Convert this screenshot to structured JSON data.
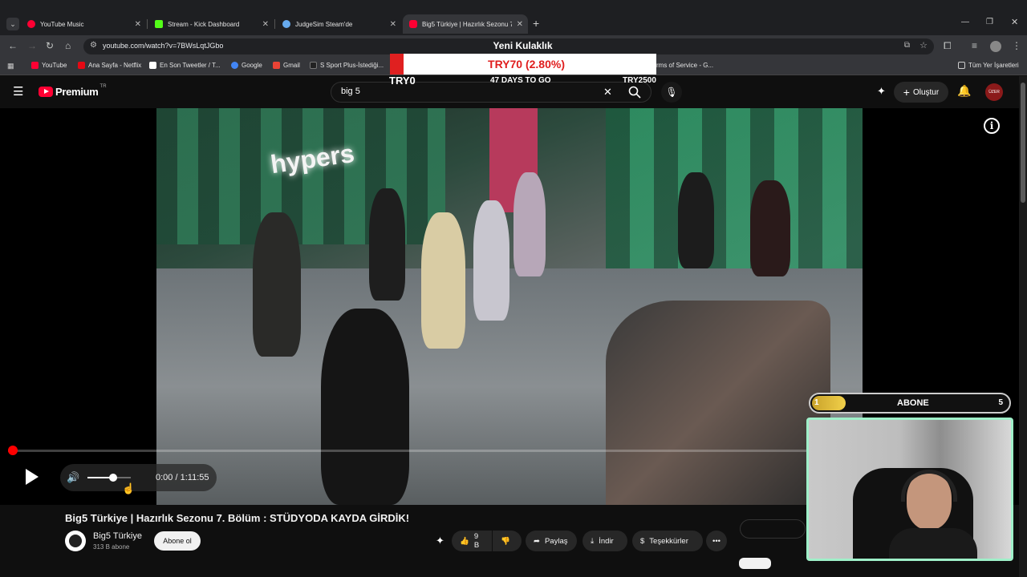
{
  "tabs": [
    {
      "title": "YouTube Music",
      "favicon_color": "#ff0033"
    },
    {
      "title": "Stream - Kick Dashboard",
      "favicon_color": "#53fc18"
    },
    {
      "title": "JudgeSim Steam'de",
      "favicon_color": "#66aaee"
    },
    {
      "title": "Big5 Türkiye | Hazırlık Sezonu 7.",
      "favicon_color": "#ff0033"
    }
  ],
  "omnibox": {
    "url": "youtube.com/watch?v=7BWsLqtJGbo"
  },
  "bookmarks": [
    {
      "label": "YouTube",
      "color": "#ff0033"
    },
    {
      "label": "Ana Sayfa - Netflix",
      "color": "#e50914"
    },
    {
      "label": "En Son Tweetler / T...",
      "color": "#ffffff"
    },
    {
      "label": "Google",
      "color": "#4285f4"
    },
    {
      "label": "Gmail",
      "color": "#ea4335"
    },
    {
      "label": "S Sport Plus-İstediği...",
      "color": "#222222"
    },
    {
      "label": "rms of Service - G...",
      "color": "#888888"
    }
  ],
  "bookmarks_all": "Tüm Yer İşaretleri",
  "youtube": {
    "logo_text": "Premium",
    "logo_region": "TR",
    "search_value": "big 5",
    "create_label": "Oluştur",
    "avatar_text": "ÜZER"
  },
  "stream_goal": {
    "title": "Yeni Kulaklık",
    "current": "TRY70 (2.80%)",
    "start": "TRY0",
    "days_left": "47 DAYS TO GO",
    "target": "TRY2500",
    "progress_percent": 2.8
  },
  "video": {
    "wall_text": "hypers",
    "time_current": "0:00",
    "time_separator": "/",
    "time_total": "1:11:55",
    "volume_fraction": 0.6,
    "played_fraction": 0.0
  },
  "details": {
    "title": "Big5 Türkiye | Hazırlık Sezonu 7. Bölüm : STÜDYODA KAYDA GİRDİK!",
    "channel": "Big5 Türkiye",
    "subscribers": "313 B abone",
    "subscribe_label": "Abone ol",
    "likes": "9 B",
    "share_label": "Paylaş",
    "download_label": "İndir",
    "thanks_label": "Teşekkürler"
  },
  "sub_goal": {
    "current": "1",
    "label": "ABONE",
    "target": "5"
  }
}
